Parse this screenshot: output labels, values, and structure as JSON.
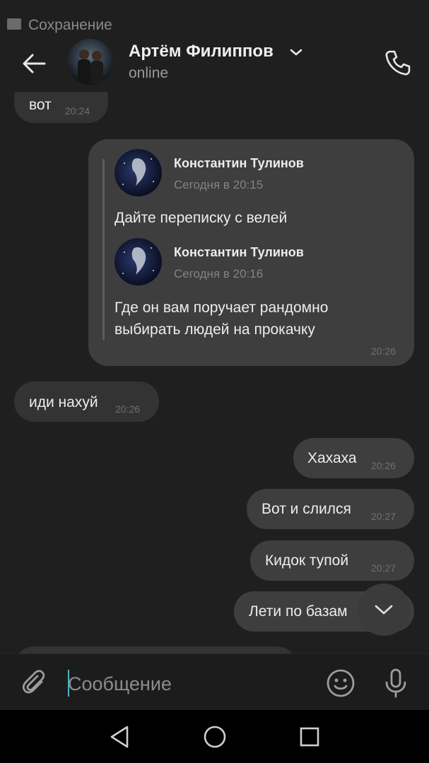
{
  "status_bar": {
    "notification_text": "Сохранение"
  },
  "header": {
    "contact_name": "Артём Филиппов",
    "contact_status": "online",
    "icons": [
      "back-arrow-icon",
      "chevron-down-icon",
      "phone-icon"
    ]
  },
  "messages": [
    {
      "direction": "incoming",
      "text": "вот",
      "time": "20:24"
    },
    {
      "direction": "outgoing",
      "time": "20:26",
      "forwarded": [
        {
          "author": "Константин Тулинов",
          "date": "Сегодня в 20:15",
          "text": "Дайте переписку с велей"
        },
        {
          "author": "Константин Тулинов",
          "date": "Сегодня в 20:16",
          "text_lines": [
            "Где он вам поручает рандомно",
            "выбирать людей на прокачку"
          ]
        }
      ]
    },
    {
      "direction": "incoming",
      "text": "иди нахуй",
      "time": "20:26"
    },
    {
      "direction": "outgoing",
      "text": "Хахаха",
      "time": "20:26"
    },
    {
      "direction": "outgoing",
      "text": "Вот и слился",
      "time": "20:27"
    },
    {
      "direction": "outgoing",
      "text": "Кидок тупой",
      "time": "20:27"
    },
    {
      "direction": "outgoing",
      "text": "Лети по базам",
      "time": ""
    }
  ],
  "composer": {
    "placeholder": "Сообщение",
    "icons": [
      "paperclip-icon",
      "emoji-icon",
      "microphone-icon"
    ]
  },
  "colors": {
    "background": "#1f1f1f",
    "incoming_bubble": "#333333",
    "outgoing_bubble": "#3e3e3e",
    "caret": "#4fb3c4"
  }
}
